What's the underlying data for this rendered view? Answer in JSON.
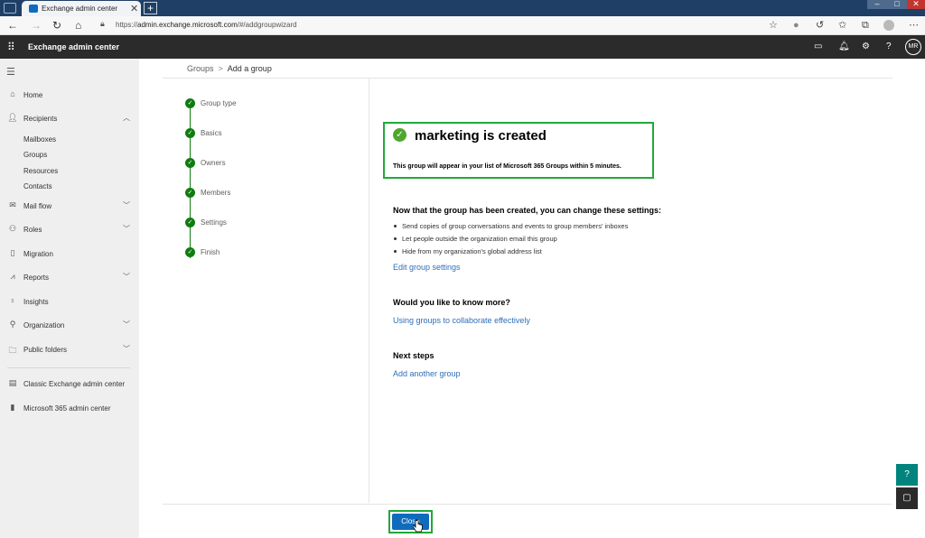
{
  "browser": {
    "tab_title": "Exchange admin center",
    "tab_close": "✕",
    "newtab": "+",
    "url_prefix": "https://",
    "url_host": "admin.exchange.microsoft.com",
    "url_path": "/#/addgroupwizard",
    "icons": [
      "back-icon",
      "forward-icon",
      "refresh-icon",
      "home-icon",
      "lock-icon",
      "add-favorite-icon",
      "tracking-icon",
      "extension-icon",
      "favorites-icon",
      "collections-icon",
      "profile-icon",
      "more-icon"
    ]
  },
  "header": {
    "app_title": "Exchange admin center",
    "avatar_initials": "MR"
  },
  "sidebar": {
    "items": [
      {
        "label": "Home",
        "icon": "home-icon"
      },
      {
        "label": "Recipients",
        "icon": "person-icon"
      },
      {
        "label": "Mail flow",
        "icon": "mail-icon"
      },
      {
        "label": "Roles",
        "icon": "roles-icon"
      },
      {
        "label": "Migration",
        "icon": "migration-icon"
      },
      {
        "label": "Reports",
        "icon": "reports-icon"
      },
      {
        "label": "Insights",
        "icon": "lightbulb-icon"
      },
      {
        "label": "Organization",
        "icon": "organization-icon"
      },
      {
        "label": "Public folders",
        "icon": "folder-icon"
      },
      {
        "label": "Classic Exchange admin center",
        "icon": "exchange-icon"
      },
      {
        "label": "Microsoft 365 admin center",
        "icon": "office-icon"
      }
    ],
    "recipients_sub": [
      "Mailboxes",
      "Groups",
      "Resources",
      "Contacts"
    ]
  },
  "breadcrumb": {
    "parent": "Groups",
    "separator": ">",
    "current": "Add a group"
  },
  "wizard_steps": [
    "Group type",
    "Basics",
    "Owners",
    "Members",
    "Settings",
    "Finish"
  ],
  "success": {
    "title": "marketing is created",
    "subtitle": "This group will appear in your list of Microsoft 365 Groups within 5 minutes."
  },
  "settings_section": {
    "heading": "Now that the group has been created, you can change these settings:",
    "bullets": [
      "Send copies of group conversations and events to group members' inboxes",
      "Let people outside the organization email this group",
      "Hide from my organization's global address list"
    ],
    "link": "Edit group settings"
  },
  "more_section": {
    "heading": "Would you like to know more?",
    "link": "Using groups to collaborate effectively"
  },
  "next_section": {
    "heading": "Next steps",
    "link": "Add another group"
  },
  "footer": {
    "close_label": "Close"
  },
  "colors": {
    "accent": "#0f6cbd",
    "success": "#107c10",
    "highlight_outline": "#21a83a",
    "link": "#2e6fb7",
    "header": "#2b2b2b"
  }
}
